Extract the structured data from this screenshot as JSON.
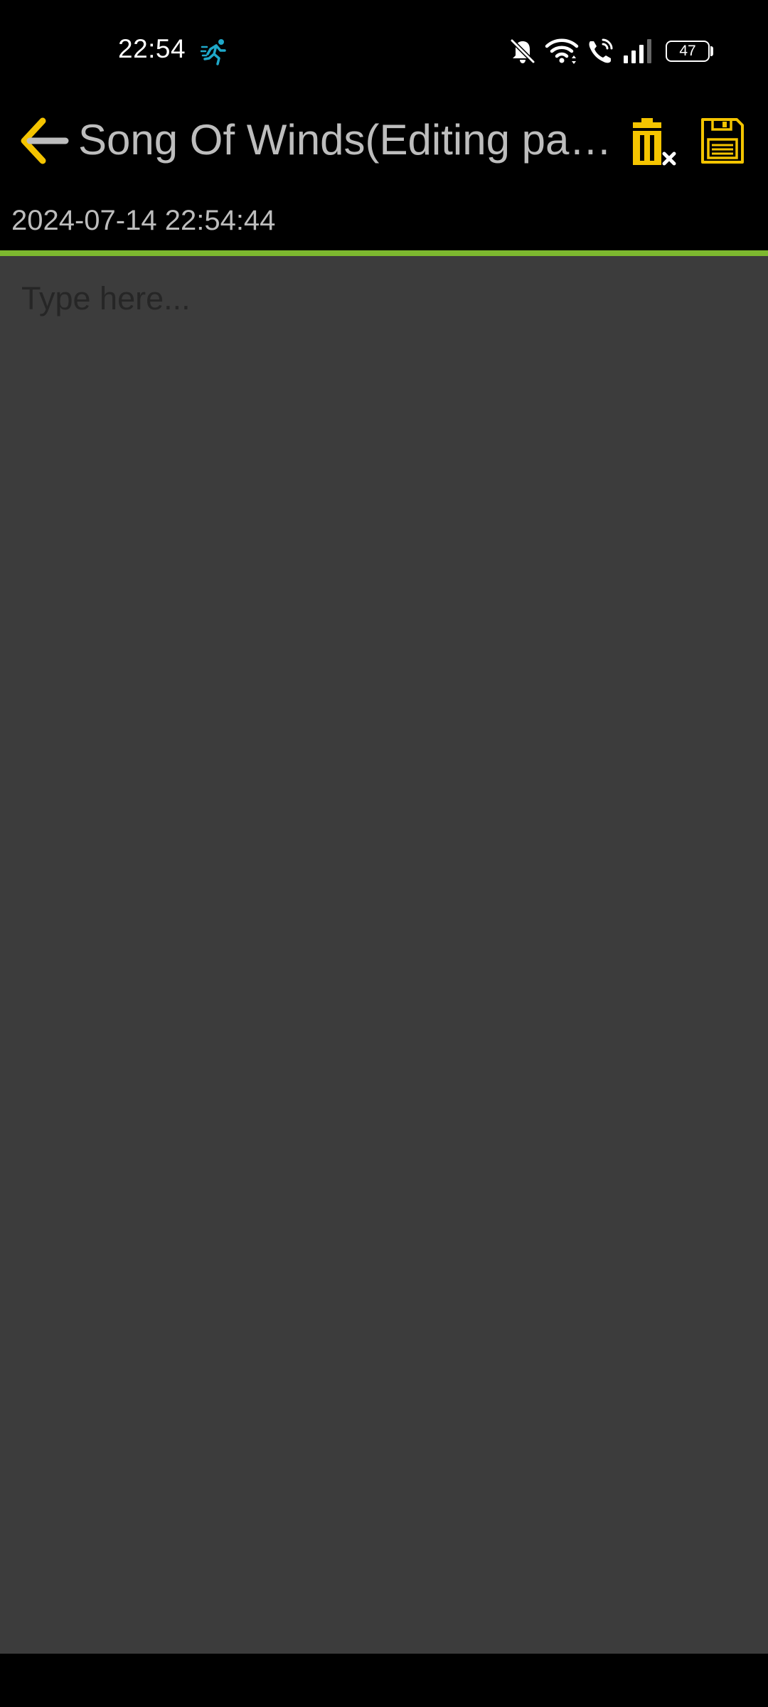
{
  "status_bar": {
    "time": "22:54",
    "battery_level": "47",
    "icons": [
      "running-activity-icon",
      "bell-muted-icon",
      "wifi-icon",
      "wifi-calling-icon",
      "signal-bars-icon",
      "battery-icon"
    ]
  },
  "app_bar": {
    "title": "Song Of Winds(Editing page)",
    "back_icon": "arrow-left-icon",
    "delete_icon": "trash-clear-icon",
    "save_icon": "floppy-disk-icon"
  },
  "note": {
    "date": "2024-07-14 22:54:44",
    "placeholder": "Type here...",
    "content": ""
  },
  "colors": {
    "accent": "#7cb82f",
    "icon_yellow": "#f4c400",
    "editor_background": "#3c3c3c",
    "title_text": "#bdbdbd",
    "status_teal": "#1fa8c9"
  }
}
